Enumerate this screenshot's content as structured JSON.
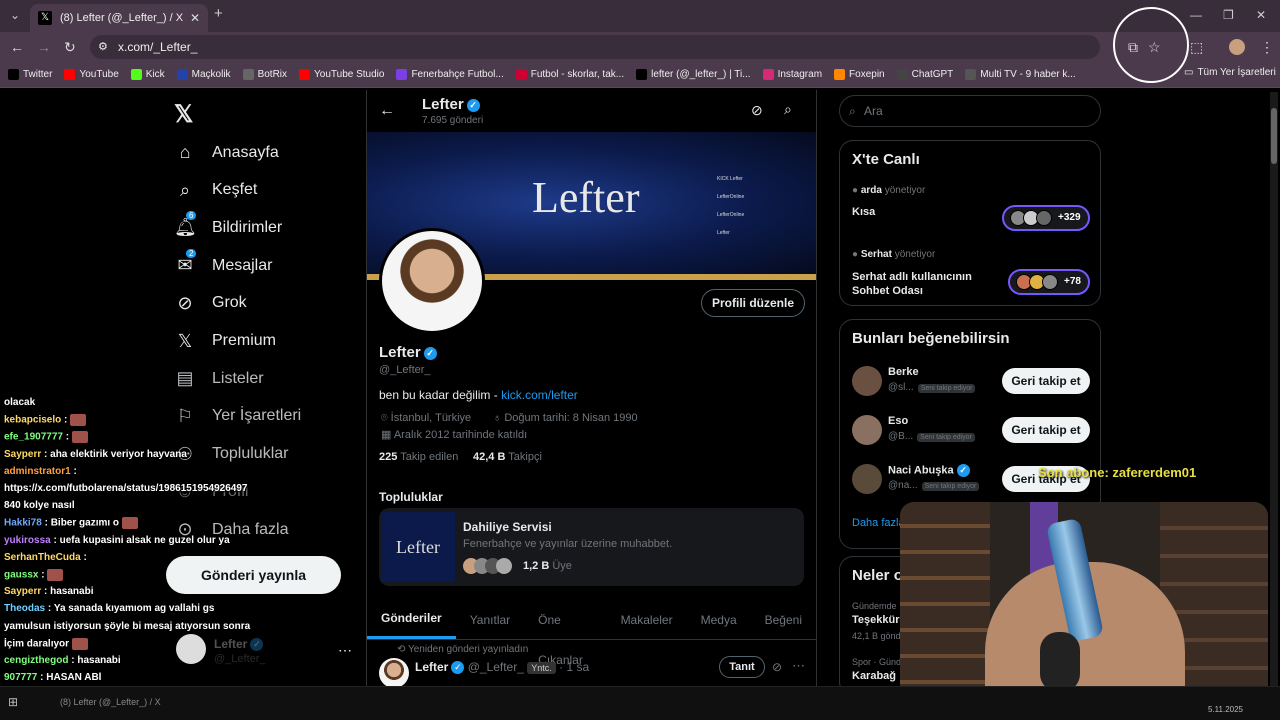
{
  "browser": {
    "tab_title": "(8) Lefter (@_Lefter_) / X",
    "url": "x.com/_Lefter_",
    "bookmarks": [
      {
        "label": "Twitter",
        "icon": "x-icon",
        "color": "#000000"
      },
      {
        "label": "YouTube",
        "icon": "youtube-icon",
        "color": "#ff0000"
      },
      {
        "label": "Kick",
        "icon": "kick-icon",
        "color": "#53fc18"
      },
      {
        "label": "Maçkolik",
        "icon": "mackolik-icon",
        "color": "#2244aa"
      },
      {
        "label": "BotRix",
        "icon": "botrix-icon",
        "color": "#666666"
      },
      {
        "label": "YouTube Studio",
        "icon": "youtube-icon",
        "color": "#ff0000"
      },
      {
        "label": "Fenerbahçe Futbol...",
        "icon": "folder-icon",
        "color": "#7b3fe4"
      },
      {
        "label": "Futbol - skorlar, tak...",
        "icon": "flashscore-icon",
        "color": "#cc0033"
      },
      {
        "label": "lefter (@_lefter_) | Ti...",
        "icon": "tiktok-icon",
        "color": "#000000"
      },
      {
        "label": "Instagram",
        "icon": "instagram-icon",
        "color": "#d62976"
      },
      {
        "label": "Foxepin",
        "icon": "foxepin-icon",
        "color": "#ff8800"
      },
      {
        "label": "ChatGPT",
        "icon": "chatgpt-icon",
        "color": "#444444"
      },
      {
        "label": "Multi TV - 9 haber k...",
        "icon": "tv-icon",
        "color": "#555555"
      }
    ],
    "all_bookmarks": "Tüm Yer İşaretleri"
  },
  "nav": {
    "items": [
      {
        "label": "Anasayfa",
        "icon": "home-icon"
      },
      {
        "label": "Keşfet",
        "icon": "search-icon"
      },
      {
        "label": "Bildirimler",
        "icon": "bell-icon",
        "badge": "6"
      },
      {
        "label": "Mesajlar",
        "icon": "mail-icon",
        "badge": "2"
      },
      {
        "label": "Grok",
        "icon": "grok-icon"
      },
      {
        "label": "Premium",
        "icon": "x-icon"
      },
      {
        "label": "Listeler",
        "icon": "list-icon"
      },
      {
        "label": "Yer İşaretleri",
        "icon": "bookmark-icon"
      },
      {
        "label": "Topluluklar",
        "icon": "people-icon"
      },
      {
        "label": "Profil",
        "icon": "user-icon"
      },
      {
        "label": "Daha fazla",
        "icon": "more-icon"
      }
    ],
    "post_button": "Gönderi yayınla",
    "account_name": "Lefter",
    "account_handle": "@_Lefter_"
  },
  "profile": {
    "header_name": "Lefter",
    "post_count": "7.695 gönderi",
    "banner_logo": "Lefter",
    "banner_links": [
      "KICK Lefter",
      "LefterOnline",
      "LefterOnline",
      "Lefter"
    ],
    "edit_button": "Profili düzenle",
    "name": "Lefter",
    "handle": "@_Lefter_",
    "bio_text": "ben bu kadar değilim - ",
    "bio_link": "kick.com/lefter",
    "location": "İstanbul, Türkiye",
    "birthday": "Doğum tarihi: 8 Nisan 1990",
    "joined": "Aralık 2012 tarihinde katıldı",
    "following_count": "225",
    "following_label": "Takip edilen",
    "followers_count": "42,4 B",
    "followers_label": "Takipçi",
    "communities_title": "Topluluklar",
    "community": {
      "name": "Dahiliye Servisi",
      "desc": "Fenerbahçe ve yayınlar üzerine muhabbet.",
      "members": "1,2 B",
      "members_label": "Üye"
    },
    "tabs": [
      "Gönderiler",
      "Yanıtlar",
      "Öne Çıkanlar",
      "Makaleler",
      "Medya",
      "Beğeni"
    ],
    "repost_label": "Yeniden gönderi yayınladın",
    "post": {
      "name": "Lefter",
      "handle": "@_Lefter_",
      "tag": "Yntc.",
      "time": "· 1 sa",
      "action": "Tanıt"
    }
  },
  "right": {
    "search_placeholder": "Ara",
    "live_title": "X'te Canlı",
    "spaces": [
      {
        "host": "arda",
        "host_label": "yönetiyor",
        "title": "Kısa",
        "count": "+329"
      },
      {
        "host": "Serhat",
        "host_label": "yönetiyor",
        "title": "Serhat adlı kullanıcının Sohbet Odası",
        "count": "+78"
      }
    ],
    "suggest_title": "Bunları beğenebilirsin",
    "suggestions": [
      {
        "name": "Berke",
        "handle": "@sl...",
        "follows_you": "Seni takip ediyor",
        "button": "Geri takip et"
      },
      {
        "name": "Eso",
        "handle": "@B...",
        "follows_you": "Seni takip ediyor",
        "button": "Geri takip et"
      },
      {
        "name": "Naci Abuşka",
        "handle": "@na...",
        "follows_you": "Seni takip ediyor",
        "button": "Geri takip et"
      }
    ],
    "more_link": "Daha fazla",
    "trends_title": "Neler o",
    "trends": [
      {
        "context": "Gündemde",
        "title": "Teşekkür",
        "count": "42,1 B gönd"
      },
      {
        "context": "Spor · Gündı",
        "title": "Karabağ"
      }
    ]
  },
  "overlay": {
    "sub_alert": "Son abone: zafererdem01",
    "chat": [
      {
        "user": "",
        "msg": "olacak",
        "color": "#ffffff"
      },
      {
        "user": "kebapciselo",
        "msg": " :",
        "color": "#ffd966",
        "emote": true
      },
      {
        "user": "efe_1907777",
        "msg": " :",
        "color": "#7fff7f",
        "emote": true
      },
      {
        "user": "Sayperr",
        "msg": " : aha elektirik veriyor hayvana",
        "color": "#ffd966"
      },
      {
        "user": "adminstrator1",
        "msg": " :",
        "color": "#ff9f40"
      },
      {
        "user": "",
        "msg": "https://x.com/futbolarena/status/1986151954926497",
        "color": "#ffffff"
      },
      {
        "user": "",
        "msg": "840 kolye nasıl",
        "color": "#ffffff"
      },
      {
        "user": "Hakki78",
        "msg": " : Biber gazımı o",
        "color": "#6fa8ff",
        "emote": true
      },
      {
        "user": "yukirossa",
        "msg": " : uefa kupasini alsak ne guzel olur ya",
        "color": "#c27fff"
      },
      {
        "user": "SerhanTheCuda",
        "msg": " :",
        "color": "#ffd966"
      },
      {
        "user": "gaussx",
        "msg": " :",
        "color": "#7fff7f",
        "emote": true
      },
      {
        "user": "Sayperr",
        "msg": " : hasanabi",
        "color": "#ffd966"
      },
      {
        "user": "Theodas",
        "msg": " : Ya sanada kıyamıom ag vallahi gs",
        "color": "#6fd0ff"
      },
      {
        "user": "",
        "msg": "yamulsun istiyorsun şöyle bi mesaj atıyorsun sonra",
        "color": "#ffffff"
      },
      {
        "user": "",
        "msg": "İçim daralıyor",
        "color": "#ffffff",
        "emote": true
      },
      {
        "user": "cengizthegod",
        "msg": " : hasanabi",
        "color": "#7fff7f"
      },
      {
        "user": "907777",
        "msg": " : HASAN ABİ",
        "color": "#7fff7f"
      }
    ]
  },
  "taskbar": {
    "window_title": "(8) Lefter (@_Lefter_) / X",
    "date": "5.11.2025"
  }
}
